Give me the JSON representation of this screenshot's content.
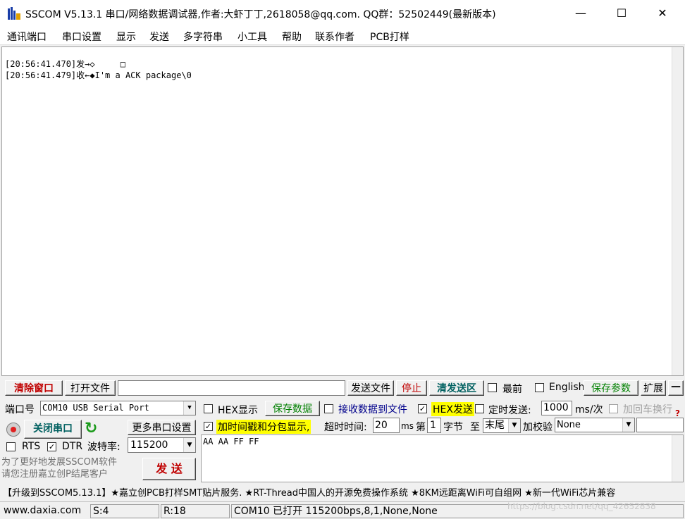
{
  "window": {
    "title": "SSCOM V5.13.1 串口/网络数据调试器,作者:大虾丁丁,2618058@qq.com. QQ群：52502449(最新版本)",
    "minimize": "—",
    "maximize": "☐",
    "close": "✕"
  },
  "menu": [
    "通讯端口",
    "串口设置",
    "显示",
    "发送",
    "多字符串",
    "小工具",
    "帮助",
    "联系作者",
    "PCB打样"
  ],
  "receive": {
    "lines": [
      "[20:56:41.470]发→◇     □",
      "[20:56:41.479]收←◆I'm a ACK package\\0"
    ]
  },
  "toolbar": {
    "clear_window": "清除窗口",
    "open_file": "打开文件",
    "file_path": "",
    "send_file": "发送文件",
    "stop": "停止",
    "clear_send": "清发送区",
    "topmost": "最前",
    "english": "English",
    "save_params": "保存参数",
    "expand": "扩展",
    "collapse": "—"
  },
  "port": {
    "port_label": "端口号",
    "port_value": "COM10 USB Serial Port",
    "close_port": "关闭串口",
    "more_settings": "更多串口设置",
    "rts": "RTS",
    "dtr": "DTR",
    "baud_label": "波特率:",
    "baud_value": "115200"
  },
  "options": {
    "hex_display": "HEX显示",
    "save_data": "保存数据",
    "recv_to_file": "接收数据到文件",
    "hex_send": "HEX发送",
    "timed_send": "定时发送:",
    "timed_value": "1000",
    "timed_unit": "ms/次",
    "add_crlf": "加回车换行",
    "timestamp": "加时间戳和分包显示,",
    "timeout_label": "超时时间:",
    "timeout_value": "20",
    "timeout_unit": "ms",
    "byte_prefix": "第",
    "byte_value": "1",
    "byte_unit": "字节",
    "to_label": "至",
    "to_value": "末尾",
    "checksum_label": "加校验",
    "checksum_value": "None"
  },
  "send": {
    "content": "AA AA FF FF",
    "promo": "为了更好地发展SSCOM软件\n请您注册嘉立创P结尾客户",
    "send_button": "发  送"
  },
  "ad_bar": "【升级到SSCOM5.13.1】★嘉立创PCB打样SMT贴片服务. ★RT-Thread中国人的开源免费操作系统 ★8KM远距离WiFi可自组网 ★新一代WiFi芯片兼容",
  "status": {
    "website": "www.daxia.com",
    "sent": "S:4",
    "received": "R:18",
    "port_status": "COM10 已打开  115200bps,8,1,None,None",
    "watermark": "https://blog.csdn.net/qq_42652838"
  }
}
